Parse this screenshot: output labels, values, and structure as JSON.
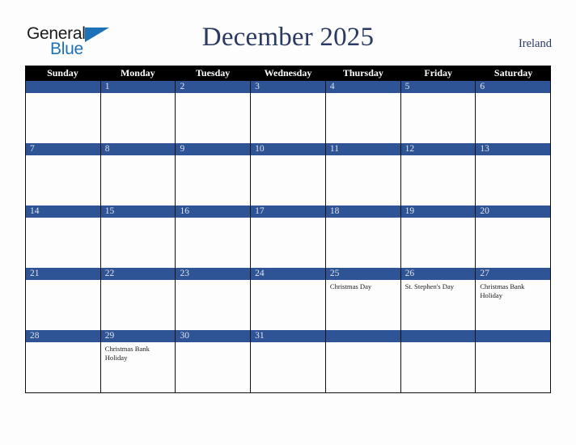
{
  "brand": {
    "name_part1": "General",
    "name_part2": "Blue",
    "triangle_icon": "triangle-icon",
    "accent_color": "#1d71b8"
  },
  "header": {
    "title": "December 2025",
    "country": "Ireland",
    "title_color": "#2b3a62"
  },
  "calendar": {
    "month": "December",
    "year": "2025",
    "weekdays": [
      "Sunday",
      "Monday",
      "Tuesday",
      "Wednesday",
      "Thursday",
      "Friday",
      "Saturday"
    ],
    "header_background": "#000000",
    "day_band_color": "#2f5496",
    "weeks": [
      [
        {
          "day": "",
          "events": []
        },
        {
          "day": "1",
          "events": []
        },
        {
          "day": "2",
          "events": []
        },
        {
          "day": "3",
          "events": []
        },
        {
          "day": "4",
          "events": []
        },
        {
          "day": "5",
          "events": []
        },
        {
          "day": "6",
          "events": []
        }
      ],
      [
        {
          "day": "7",
          "events": []
        },
        {
          "day": "8",
          "events": []
        },
        {
          "day": "9",
          "events": []
        },
        {
          "day": "10",
          "events": []
        },
        {
          "day": "11",
          "events": []
        },
        {
          "day": "12",
          "events": []
        },
        {
          "day": "13",
          "events": []
        }
      ],
      [
        {
          "day": "14",
          "events": []
        },
        {
          "day": "15",
          "events": []
        },
        {
          "day": "16",
          "events": []
        },
        {
          "day": "17",
          "events": []
        },
        {
          "day": "18",
          "events": []
        },
        {
          "day": "19",
          "events": []
        },
        {
          "day": "20",
          "events": []
        }
      ],
      [
        {
          "day": "21",
          "events": []
        },
        {
          "day": "22",
          "events": []
        },
        {
          "day": "23",
          "events": []
        },
        {
          "day": "24",
          "events": []
        },
        {
          "day": "25",
          "events": [
            "Christmas Day"
          ]
        },
        {
          "day": "26",
          "events": [
            "St. Stephen's Day"
          ]
        },
        {
          "day": "27",
          "events": [
            "Christmas Bank Holiday"
          ]
        }
      ],
      [
        {
          "day": "28",
          "events": []
        },
        {
          "day": "29",
          "events": [
            "Christmas Bank Holiday"
          ]
        },
        {
          "day": "30",
          "events": []
        },
        {
          "day": "31",
          "events": []
        },
        {
          "day": "",
          "events": []
        },
        {
          "day": "",
          "events": []
        },
        {
          "day": "",
          "events": []
        }
      ]
    ]
  }
}
